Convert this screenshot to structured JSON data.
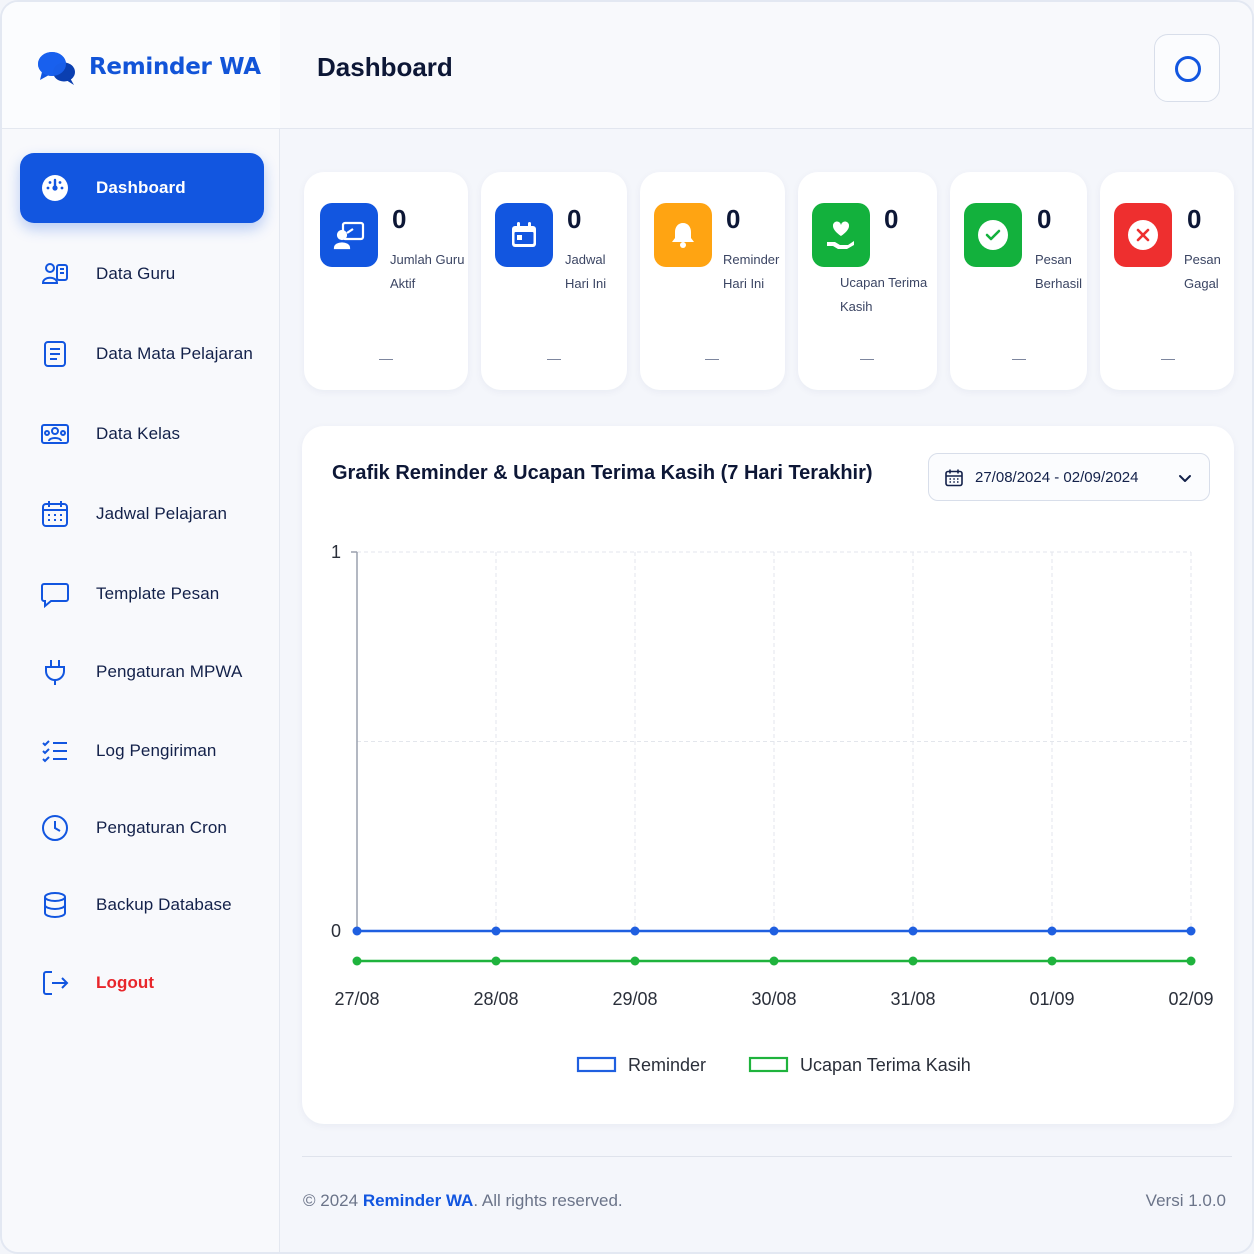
{
  "brand": {
    "name": "Reminder WA",
    "icon": "chat-bubbles-icon"
  },
  "header": {
    "title": "Dashboard",
    "action_icon": "circle-icon"
  },
  "sidebar": {
    "items": [
      {
        "label": "Dashboard",
        "icon": "dashboard-gauge-icon",
        "active": true
      },
      {
        "label": "Data Guru",
        "icon": "teacher-icon"
      },
      {
        "label": "Data Mata Pelajaran",
        "icon": "document-list-icon"
      },
      {
        "label": "Data Kelas",
        "icon": "classroom-icon"
      },
      {
        "label": "Jadwal Pelajaran",
        "icon": "calendar-icon"
      },
      {
        "label": "Template Pesan",
        "icon": "message-square-icon"
      },
      {
        "label": "Pengaturan MPWA",
        "icon": "plug-icon"
      },
      {
        "label": "Log Pengiriman",
        "icon": "checklist-icon"
      },
      {
        "label": "Pengaturan Cron",
        "icon": "clock-icon"
      },
      {
        "label": "Backup Database",
        "icon": "database-icon"
      },
      {
        "label": "Logout",
        "icon": "logout-icon"
      }
    ]
  },
  "stats": [
    {
      "value": "0",
      "label_lines": [
        "Jumlah Guru",
        "Aktif"
      ],
      "icon": "teacher-board-icon",
      "color": "#1256e0",
      "footer": "—"
    },
    {
      "value": "0",
      "label_lines": [
        "Jadwal",
        "Hari Ini"
      ],
      "icon": "calendar-icon",
      "color": "#1256e0",
      "footer": "—"
    },
    {
      "value": "0",
      "label_lines": [
        "Reminder",
        "Hari Ini"
      ],
      "icon": "bell-icon",
      "color": "#ffa412",
      "footer": "—"
    },
    {
      "value": "0",
      "label_lines": [
        "Ucapan Terima",
        "Kasih"
      ],
      "icon": "heart-hand-icon",
      "color": "#13b13d",
      "footer": "—"
    },
    {
      "value": "0",
      "label_lines": [
        "Pesan",
        "Berhasil"
      ],
      "icon": "check-circle-icon",
      "color": "#13b13d",
      "footer": "—"
    },
    {
      "value": "0",
      "label_lines": [
        "Pesan",
        "Gagal"
      ],
      "icon": "x-circle-icon",
      "color": "#ee2f2f",
      "footer": "—"
    }
  ],
  "chart": {
    "date_range": "27/08/2024 - 02/09/2024",
    "date_icon": "calendar-icon",
    "dropdown_icon": "chevron-down-icon"
  },
  "chart_data": {
    "type": "line",
    "title": "Grafik Reminder & Ucapan Terima Kasih (7 Hari Terakhir)",
    "categories": [
      "27/08",
      "28/08",
      "29/08",
      "30/08",
      "31/08",
      "01/09",
      "02/09"
    ],
    "series": [
      {
        "name": "Reminder",
        "values": [
          0,
          0,
          0,
          0,
          0,
          0,
          0
        ],
        "color": "#1f5fe0"
      },
      {
        "name": "Ucapan Terima Kasih",
        "values": [
          0,
          0,
          0,
          0,
          0,
          0,
          0
        ],
        "color": "#1fb33d"
      }
    ],
    "y_ticks": [
      "0",
      "1"
    ],
    "ylim": [
      0,
      1
    ],
    "grid": true,
    "legend": "bottom"
  },
  "footer": {
    "copyright": "© 2024",
    "brand": "Reminder WA",
    "rights": ". All rights reserved.",
    "version": "Versi 1.0.0"
  }
}
